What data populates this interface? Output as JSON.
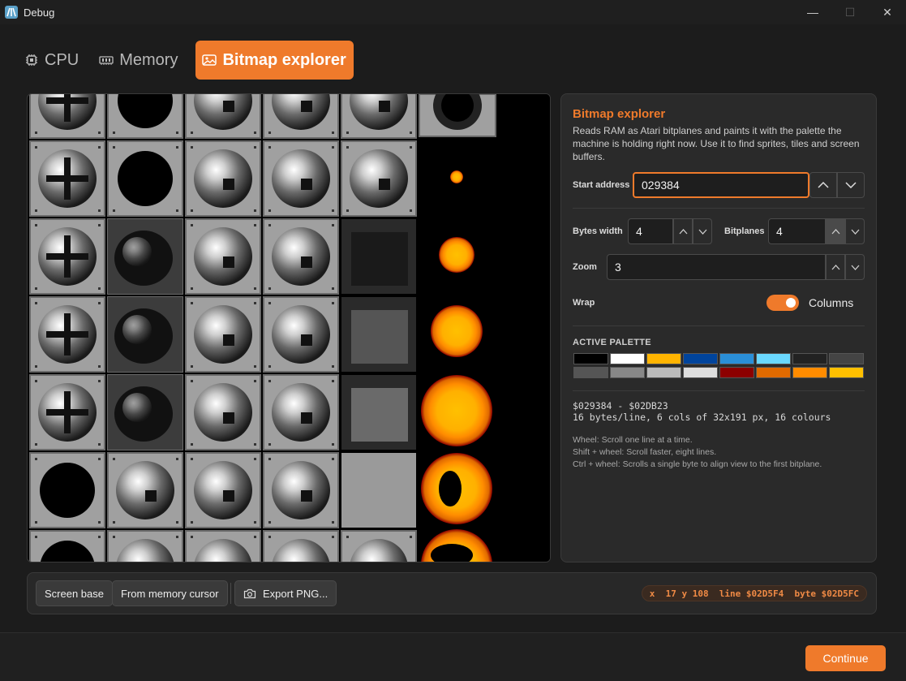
{
  "window": {
    "title": "Debug",
    "minimize": "—",
    "maximize": "☐",
    "close": "✕"
  },
  "tabs": [
    {
      "label": "CPU",
      "icon": "cpu-icon",
      "active": false
    },
    {
      "label": "Memory",
      "icon": "memory-icon",
      "active": false
    },
    {
      "label": "Bitmap explorer",
      "icon": "image-icon",
      "active": true
    }
  ],
  "panel": {
    "title": "Bitmap explorer",
    "description": "Reads RAM as Atari bitplanes and paints it with the palette the machine is holding right now. Use it to find sprites, tiles and screen buffers.",
    "start_address_label": "Start address",
    "start_address_value": "029384",
    "bytes_width_label": "Bytes width",
    "bytes_width_value": "4",
    "bitplanes_label": "Bitplanes",
    "bitplanes_value": "4",
    "zoom_label": "Zoom",
    "zoom_value": "3",
    "wrap_label": "Wrap",
    "wrap_toggle_label": "Columns",
    "wrap_on": true,
    "palette_title": "ACTIVE PALETTE",
    "palette": [
      "#000000",
      "#ffffff",
      "#ffb400",
      "#00449c",
      "#2a8fd8",
      "#6ad8ff",
      "#222222",
      "#444444",
      "#555555",
      "#888888",
      "#bbbbbb",
      "#dddddd",
      "#8c0000",
      "#e06a00",
      "#ff8c00",
      "#ffc000"
    ],
    "range_line": "$029384 - $02DB23",
    "format_line": "16 bytes/line, 6 cols of 32x191 px, 16 colours",
    "help": [
      "Wheel: Scroll one line at a time.",
      "Shift + wheel: Scroll faster, eight lines.",
      "Ctrl + wheel: Scrolls a single byte to align view to the first bitplane."
    ]
  },
  "toolbar": {
    "screen_base": "Screen base",
    "from_cursor": "From memory cursor",
    "export_png": "Export PNG...",
    "status": "x  17 y 108  line $02D5F4  byte $02D5FC"
  },
  "footer": {
    "continue": "Continue"
  },
  "colors": {
    "accent": "#ef7a2b"
  }
}
